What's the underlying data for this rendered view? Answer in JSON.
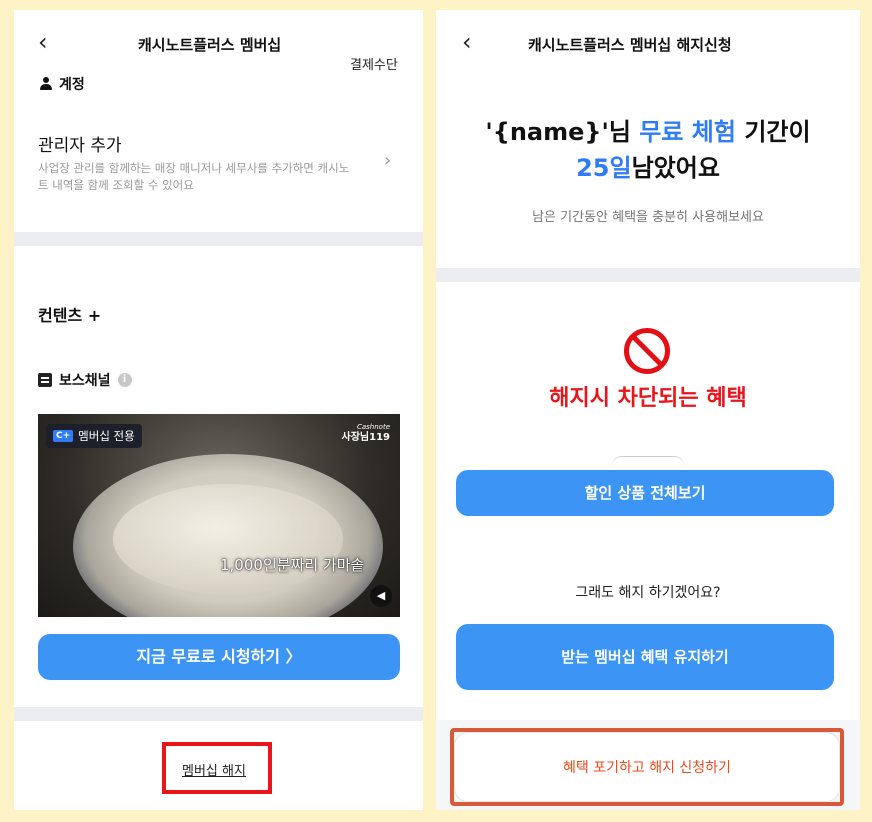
{
  "left": {
    "nav_title": "캐시노트플러스 멤버십",
    "back_icon": "chevron-left-icon",
    "payment_link": "결제수단",
    "account_label": "계정",
    "admin": {
      "title": "관리자 추가",
      "description": "사업장 관리를 함께하는 매장 매니저나 세무사를 추가하면 캐시노트 내역을 함께 조회할 수 있어요"
    },
    "contents_title": "컨텐츠 +",
    "boss_channel": "보스채널",
    "video": {
      "badge_prefix": "C+",
      "badge": "멤버십 전용",
      "logo_top": "Cashnote",
      "logo": "사장님119",
      "caption": "1,000인분짜리 가마솥"
    },
    "watch_button": "지금 무료로 시청하기  〉",
    "cancel_link": "멤버십 해지"
  },
  "right": {
    "nav_title": "캐시노트플러스 멤버십 해지신청",
    "headline": {
      "part1": "'{name}'님 ",
      "highlight1": "무료 체험",
      "part2": " 기간이",
      "highlight2": "25일",
      "part3": "남았어요"
    },
    "subtitle": "남은 기간동안 혜택을 충분히 사용해보세요",
    "blocked_title": "해지시 차단되는 혜택",
    "view_discount_button": "할인 상품 전체보기",
    "question": "그래도 해지 하기겠어요?",
    "keep_button": "받는 멤버십 혜택 유지하기",
    "quit_button": "혜택 포기하고 해지 신청하기"
  },
  "colors": {
    "primary_blue": "#3c95f5",
    "accent_blue": "#2f7cf6",
    "alert_red": "#e8161b",
    "highlight_box_orange": "#d85a3a",
    "background": "#fdf3c6"
  }
}
